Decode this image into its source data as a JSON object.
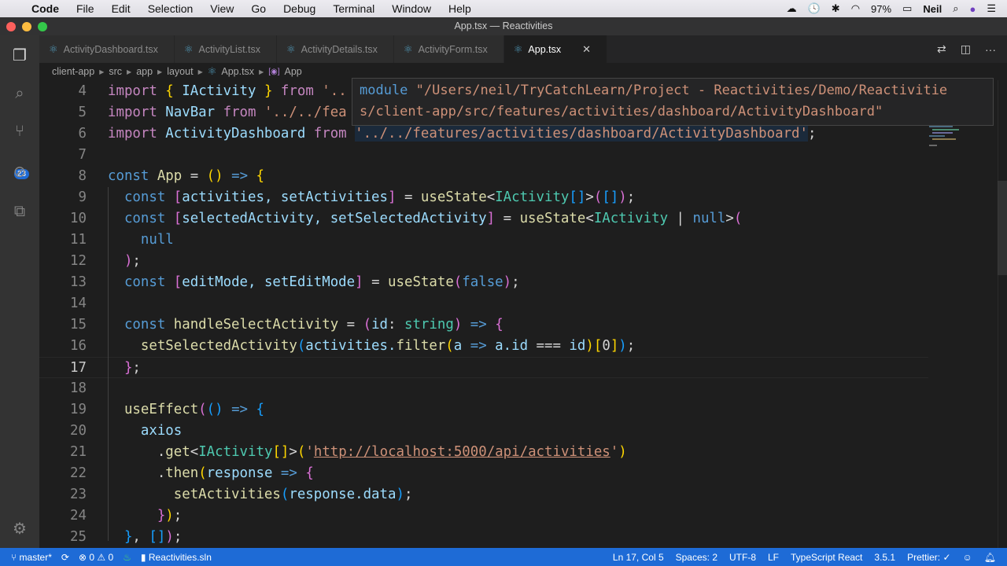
{
  "menubar": {
    "app": "Code",
    "items": [
      "File",
      "Edit",
      "Selection",
      "View",
      "Go",
      "Debug",
      "Terminal",
      "Window",
      "Help"
    ],
    "battery": "97%",
    "user": "Neil"
  },
  "window": {
    "title": "App.tsx — Reactivities"
  },
  "activity_bar": {
    "scm_badge": "23"
  },
  "tabs": [
    {
      "label": "ActivityDashboard.tsx"
    },
    {
      "label": "ActivityList.tsx"
    },
    {
      "label": "ActivityDetails.tsx"
    },
    {
      "label": "ActivityForm.tsx"
    },
    {
      "label": "App.tsx",
      "active": true
    }
  ],
  "breadcrumb": [
    "client-app",
    "src",
    "app",
    "layout",
    "App.tsx",
    "App"
  ],
  "hover": {
    "keyword": "module",
    "line1": " \"/Users/neil/TryCatchLearn/Project - Reactivities/Demo/Reactivitie",
    "line2": "s/client-app/src/features/activities/dashboard/ActivityDashboard\""
  },
  "editor": {
    "current_line": 17,
    "lines": [
      {
        "n": "4",
        "t": [
          [
            "import ",
            "kw"
          ],
          [
            "{ ",
            "b1"
          ],
          [
            "IActivity ",
            "v"
          ],
          [
            "} ",
            "b1"
          ],
          [
            "from ",
            "kw"
          ],
          [
            "'..",
            "str"
          ]
        ]
      },
      {
        "n": "5",
        "t": [
          [
            "import ",
            "kw"
          ],
          [
            "NavBar ",
            "v"
          ],
          [
            "from ",
            "kw"
          ],
          [
            "'../../fea",
            "str"
          ]
        ]
      },
      {
        "n": "6",
        "t": [
          [
            "import ",
            "kw"
          ],
          [
            "ActivityDashboard ",
            "v"
          ],
          [
            "from ",
            "kw"
          ],
          [
            "'../../features/activities/dashboard/ActivityDashboard'",
            "str sel"
          ],
          [
            ";",
            "p"
          ]
        ]
      },
      {
        "n": "7",
        "t": []
      },
      {
        "n": "8",
        "t": [
          [
            "const ",
            "st"
          ],
          [
            "App ",
            "fn"
          ],
          [
            "= ",
            "p"
          ],
          [
            "() ",
            "b1"
          ],
          [
            "=> ",
            "st"
          ],
          [
            "{",
            "b1"
          ]
        ]
      },
      {
        "n": "9",
        "t": [
          [
            "  const ",
            "st"
          ],
          [
            "[",
            "b2"
          ],
          [
            "activities, setActivities",
            "v"
          ],
          [
            "]",
            "b2"
          ],
          [
            " = ",
            "p"
          ],
          [
            "useState",
            "fn"
          ],
          [
            "<",
            "p"
          ],
          [
            "IActivity",
            "ty"
          ],
          [
            "[]",
            "b3"
          ],
          [
            ">",
            "p"
          ],
          [
            "(",
            "b2"
          ],
          [
            "[]",
            "b3"
          ],
          [
            ")",
            "b2"
          ],
          [
            ";",
            "p"
          ]
        ]
      },
      {
        "n": "10",
        "t": [
          [
            "  const ",
            "st"
          ],
          [
            "[",
            "b2"
          ],
          [
            "selectedActivity, setSelectedActivity",
            "v"
          ],
          [
            "]",
            "b2"
          ],
          [
            " = ",
            "p"
          ],
          [
            "useState",
            "fn"
          ],
          [
            "<",
            "p"
          ],
          [
            "IActivity ",
            "ty"
          ],
          [
            "| ",
            "p"
          ],
          [
            "null",
            "st"
          ],
          [
            ">",
            "p"
          ],
          [
            "(",
            "b2"
          ]
        ]
      },
      {
        "n": "11",
        "t": [
          [
            "    null",
            "st"
          ]
        ]
      },
      {
        "n": "12",
        "t": [
          [
            "  )",
            "b2"
          ],
          [
            ";",
            "p"
          ]
        ]
      },
      {
        "n": "13",
        "t": [
          [
            "  const ",
            "st"
          ],
          [
            "[",
            "b2"
          ],
          [
            "editMode, setEditMode",
            "v"
          ],
          [
            "]",
            "b2"
          ],
          [
            " = ",
            "p"
          ],
          [
            "useState",
            "fn"
          ],
          [
            "(",
            "b2"
          ],
          [
            "false",
            "st"
          ],
          [
            ")",
            "b2"
          ],
          [
            ";",
            "p"
          ]
        ]
      },
      {
        "n": "14",
        "t": []
      },
      {
        "n": "15",
        "t": [
          [
            "  const ",
            "st"
          ],
          [
            "handleSelectActivity ",
            "fn"
          ],
          [
            "= ",
            "p"
          ],
          [
            "(",
            "b2"
          ],
          [
            "id",
            "v"
          ],
          [
            ": ",
            "p"
          ],
          [
            "string",
            "ty"
          ],
          [
            ") ",
            "b2"
          ],
          [
            "=> ",
            "st"
          ],
          [
            "{",
            "b2"
          ]
        ]
      },
      {
        "n": "16",
        "t": [
          [
            "    setSelectedActivity",
            "fn"
          ],
          [
            "(",
            "b3"
          ],
          [
            "activities.",
            "v"
          ],
          [
            "filter",
            "fn"
          ],
          [
            "(",
            "b1"
          ],
          [
            "a ",
            "v"
          ],
          [
            "=> ",
            "st"
          ],
          [
            "a.id ",
            "v"
          ],
          [
            "=== ",
            "p"
          ],
          [
            "id",
            "v"
          ],
          [
            ")",
            "b1"
          ],
          [
            "[",
            "b1"
          ],
          [
            "0",
            "p"
          ],
          [
            "]",
            "b1"
          ],
          [
            ")",
            "b3"
          ],
          [
            ";",
            "p"
          ]
        ]
      },
      {
        "n": "17",
        "t": [
          [
            "  }",
            "b2"
          ],
          [
            ";",
            "p"
          ]
        ]
      },
      {
        "n": "18",
        "t": []
      },
      {
        "n": "19",
        "t": [
          [
            "  useEffect",
            "fn"
          ],
          [
            "(",
            "b2"
          ],
          [
            "() ",
            "b3"
          ],
          [
            "=> ",
            "st"
          ],
          [
            "{",
            "b3"
          ]
        ]
      },
      {
        "n": "20",
        "t": [
          [
            "    axios",
            "v"
          ]
        ]
      },
      {
        "n": "21",
        "t": [
          [
            "      .",
            "p"
          ],
          [
            "get",
            "fn"
          ],
          [
            "<",
            "p"
          ],
          [
            "IActivity",
            "ty"
          ],
          [
            "[]",
            "b1"
          ],
          [
            ">",
            "p"
          ],
          [
            "(",
            "b1"
          ],
          [
            "'",
            "str"
          ],
          [
            "http://localhost:5000/api/activities",
            "url"
          ],
          [
            "'",
            "str"
          ],
          [
            ")",
            "b1"
          ]
        ]
      },
      {
        "n": "22",
        "t": [
          [
            "      .",
            "p"
          ],
          [
            "then",
            "fn"
          ],
          [
            "(",
            "b1"
          ],
          [
            "response ",
            "v"
          ],
          [
            "=> ",
            "st"
          ],
          [
            "{",
            "b2"
          ]
        ]
      },
      {
        "n": "23",
        "t": [
          [
            "        setActivities",
            "fn"
          ],
          [
            "(",
            "b3"
          ],
          [
            "response.data",
            "v"
          ],
          [
            ")",
            "b3"
          ],
          [
            ";",
            "p"
          ]
        ]
      },
      {
        "n": "24",
        "t": [
          [
            "      }",
            "b2"
          ],
          [
            ")",
            "b1"
          ],
          [
            ";",
            "p"
          ]
        ]
      },
      {
        "n": "25",
        "t": [
          [
            "  }",
            "b3"
          ],
          [
            ", ",
            "p"
          ],
          [
            "[]",
            "b3"
          ],
          [
            ")",
            "b2"
          ],
          [
            ";",
            "p"
          ]
        ]
      }
    ]
  },
  "statusbar": {
    "branch": "master*",
    "errors": "0",
    "warnings": "0",
    "solution": "Reactivities.sln",
    "position": "Ln 17, Col 5",
    "spaces": "Spaces: 2",
    "encoding": "UTF-8",
    "eol": "LF",
    "language": "TypeScript React",
    "ts_version": "3.5.1",
    "prettier": "Prettier: ✓"
  }
}
